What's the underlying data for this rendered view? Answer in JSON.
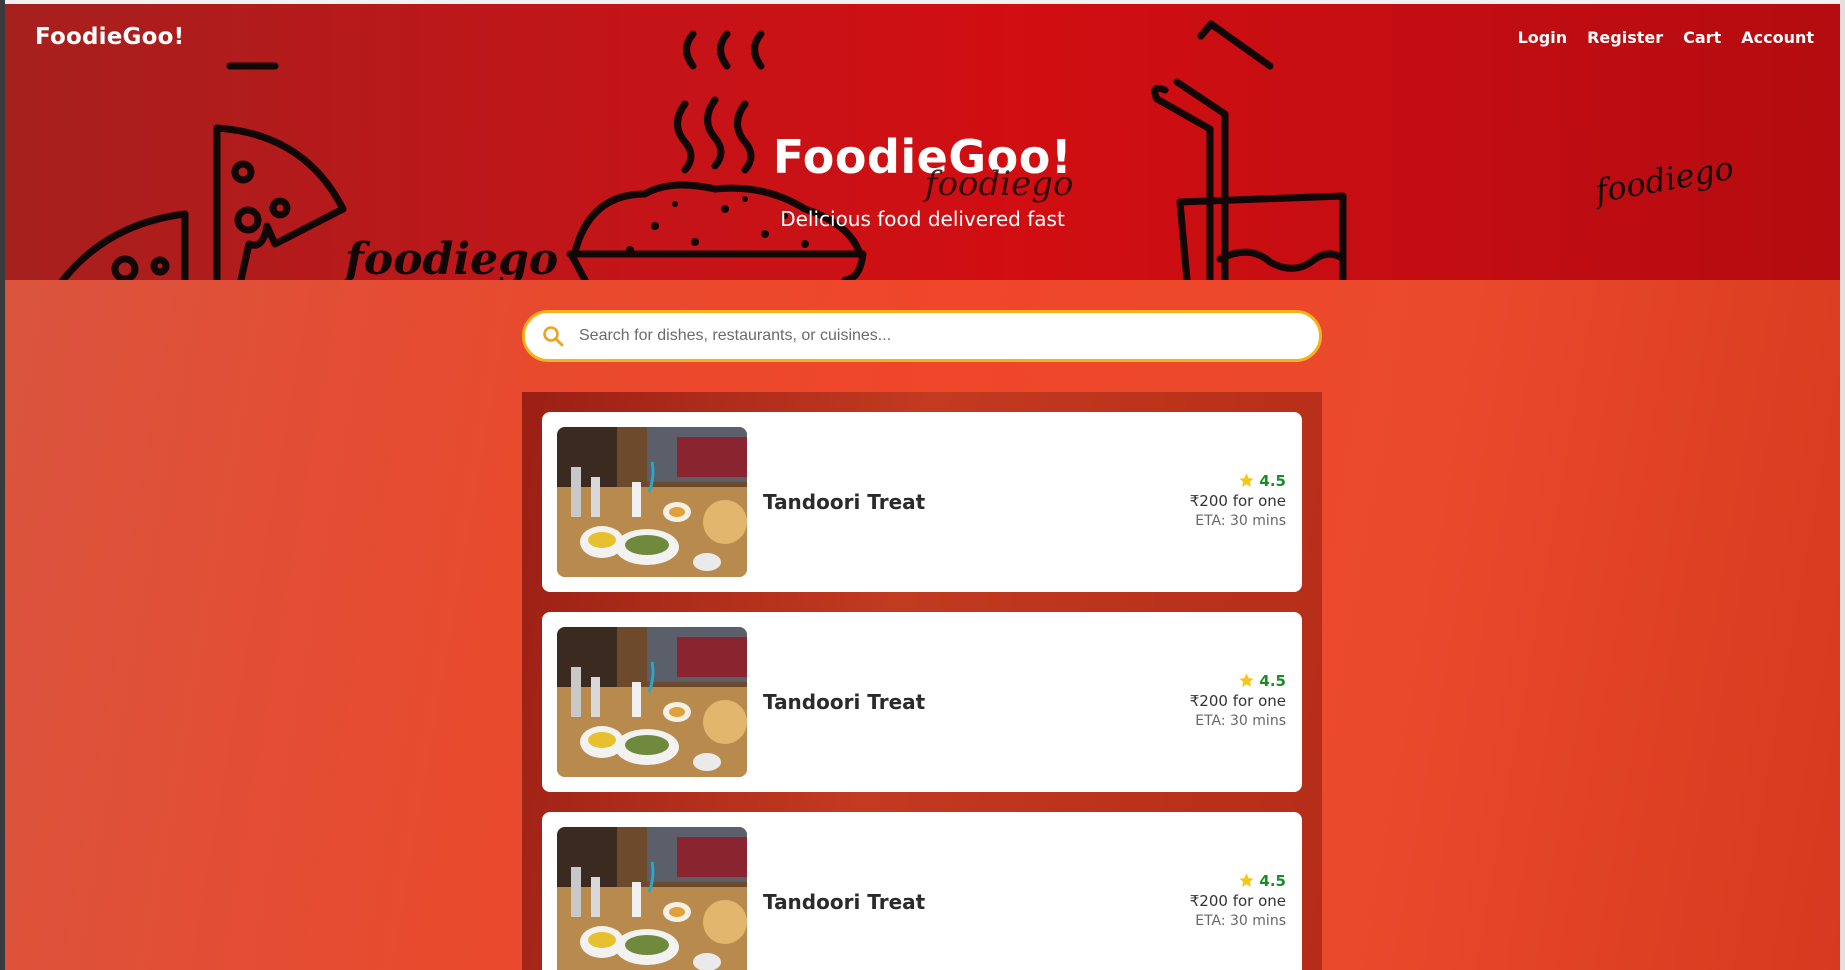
{
  "nav": {
    "brand": "FoodieGoo!",
    "links": [
      "Login",
      "Register",
      "Cart",
      "Account"
    ]
  },
  "hero": {
    "title": "FoodieGoo!",
    "script_text": "foodiego",
    "subtitle": "Delicious food delivered fast",
    "decor_text_left": "foodiego",
    "decor_text_right": "foodiego"
  },
  "search": {
    "placeholder": "Search for dishes, restaurants, or cuisines...",
    "value": ""
  },
  "restaurants": [
    {
      "name": "Tandoori Treat",
      "rating": "4.5",
      "price": "₹200 for one",
      "eta": "ETA: 30 mins"
    },
    {
      "name": "Tandoori Treat",
      "rating": "4.5",
      "price": "₹200 for one",
      "eta": "ETA: 30 mins"
    },
    {
      "name": "Tandoori Treat",
      "rating": "4.5",
      "price": "₹200 for one",
      "eta": "ETA: 30 mins"
    }
  ],
  "icons": {
    "search": "search-icon",
    "star": "star-icon"
  },
  "colors": {
    "hero_red": "#c41418",
    "search_border": "#f5b21b",
    "rating_green": "#1c8a26",
    "star_yellow": "#f5c518"
  }
}
